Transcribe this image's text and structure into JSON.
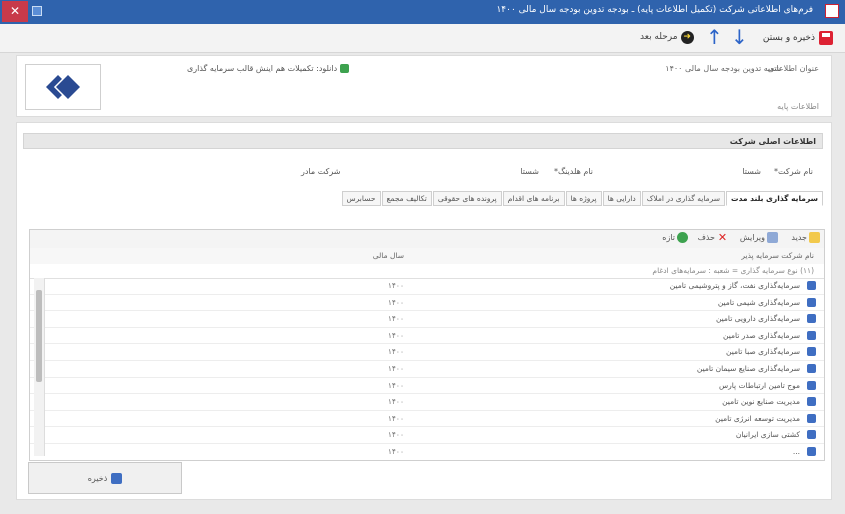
{
  "window": {
    "title": "فرم‌های اطلاعاتی شرکت (تکمیل اطلاعات پایه) ـ بودجه تدوین بودجه سال مالی ۱۴۰۰",
    "close_glyph": "✕"
  },
  "toolbar": {
    "save_label": "ذخیره و بستن",
    "next_label": "مرحله بعد",
    "up_glyph": "↑",
    "down_glyph": "↓"
  },
  "header": {
    "title_label": "عنوان اطلاعاتی",
    "title_value": "شعبه تدوین بودجه سال مالی ۱۴۰۰",
    "help_link": "دانلود: تکمیلات هم اینش قالب سرمایه گذاری",
    "desc_label": "اطلاعات پایه"
  },
  "section": {
    "title": "اطلاعات اصلی شرکت",
    "company_name_label": "نام شرکت*",
    "company_name_value": "شستا",
    "holding_label": "نام هلدینگ*",
    "holding_value": "شستا",
    "parent_label": "شرکت مادر"
  },
  "tabs": [
    {
      "label": "سرمایه گذاری بلند مدت",
      "active": true
    },
    {
      "label": "سرمایه گذاری در املاک",
      "active": false
    },
    {
      "label": "دارایی ها",
      "active": false
    },
    {
      "label": "پروژه ها",
      "active": false
    },
    {
      "label": "برنامه های اقدام",
      "active": false
    },
    {
      "label": "پرونده های حقوقی",
      "active": false
    },
    {
      "label": "تکالیف مجمع",
      "active": false
    },
    {
      "label": "حسابرس",
      "active": false
    }
  ],
  "grid_toolbar": {
    "new_label": "جدید",
    "edit_label": "ویرایش",
    "delete_label": "حذف",
    "refresh_label": "تازه"
  },
  "grid": {
    "col_company": "نام شرکت سرمایه پذیر",
    "col_year": "سال مالی",
    "filter_text": "(۱۱) نوع سرمایه گذاری = شعبه : سرمایه‌های ادغام",
    "rows": [
      {
        "name": "سرمایه‌گذاری نفت، گاز و پتروشیمی تامین",
        "year": "۱۴۰۰"
      },
      {
        "name": "سرمایه‌گذاری شیمی تامین",
        "year": "۱۴۰۰"
      },
      {
        "name": "سرمایه‌گذاری دارویی تامین",
        "year": "۱۴۰۰"
      },
      {
        "name": "سرمایه‌گذاری صدر تامین",
        "year": "۱۴۰۰"
      },
      {
        "name": "سرمایه‌گذاری صبا تامین",
        "year": "۱۴۰۰"
      },
      {
        "name": "سرمایه‌گذاری صنایع سیمان تامین",
        "year": "۱۴۰۰"
      },
      {
        "name": "موج تامین ارتباطات پارس",
        "year": "۱۴۰۰"
      },
      {
        "name": "مدیریت صنایع نوین تامین",
        "year": "۱۴۰۰"
      },
      {
        "name": "مدیریت توسعه انرژی تامین",
        "year": "۱۴۰۰"
      },
      {
        "name": "کشتی سازی ایرانیان",
        "year": "۱۴۰۰"
      },
      {
        "name": "...",
        "year": "۱۴۰۰"
      }
    ]
  },
  "bottom": {
    "save_label": "ذخیره"
  }
}
